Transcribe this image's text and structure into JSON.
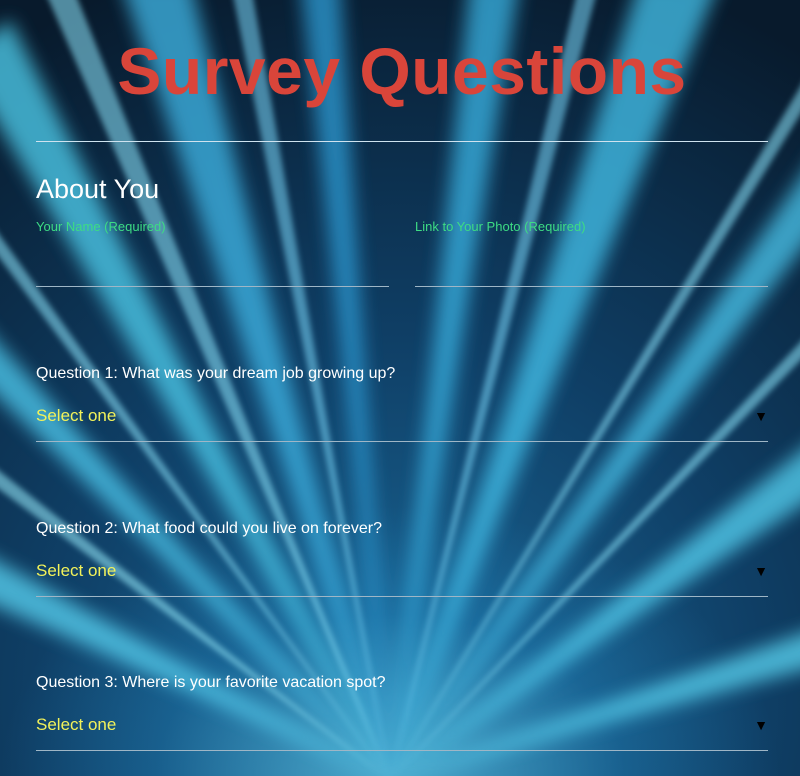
{
  "page": {
    "title": "Survey Questions"
  },
  "about": {
    "heading": "About You",
    "name_label": "Your Name (Required)",
    "name_value": "",
    "photo_label": "Link to Your Photo (Required)",
    "photo_value": ""
  },
  "questions": [
    {
      "label": "Question 1: What was your dream job growing up?",
      "selected": "Select one"
    },
    {
      "label": "Question 2: What food could you live on forever?",
      "selected": "Select one"
    },
    {
      "label": "Question 3: Where is your favorite vacation spot?",
      "selected": "Select one"
    }
  ],
  "colors": {
    "title": "#d9453a",
    "field_label": "#3ddc84",
    "select_text": "#f2f25a",
    "text": "#ffffff"
  },
  "icons": {
    "dropdown_arrow": "triangle-down",
    "arrow_glyph": "▼"
  }
}
